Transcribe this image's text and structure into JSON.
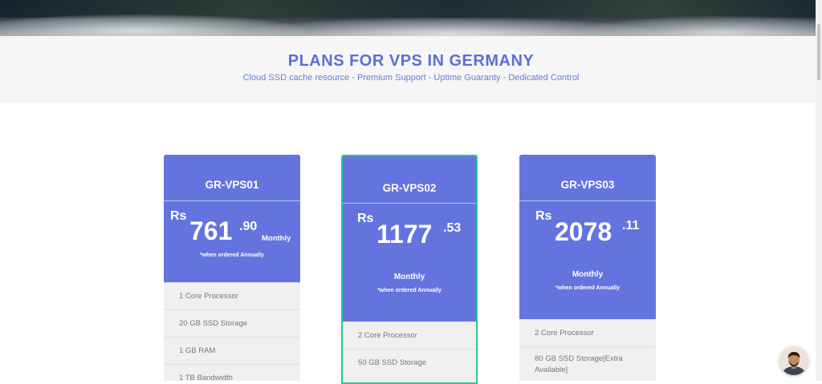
{
  "header": {
    "title": "PLANS FOR VPS IN GERMANY",
    "subtitle": "Cloud SSD cache resource - Premium Support - Uptime Guaranty - Dedicated Control"
  },
  "plans": [
    {
      "name": "GR-VPS01",
      "currency": "Rs",
      "amount": "761",
      "decimals": ".90",
      "period": "Monthly",
      "note": "*when ordered Annually",
      "features": [
        "1 Core Processor",
        "20 GB SSD Storage",
        "1 GB RAM",
        "1 TB Bandwidth"
      ]
    },
    {
      "name": "GR-VPS02",
      "currency": "Rs",
      "amount": "1177",
      "decimals": ".53",
      "period": "Monthly",
      "note": "*when ordered Annually",
      "features": [
        "2 Core Processor",
        "50 GB SSD Storage"
      ]
    },
    {
      "name": "GR-VPS03",
      "currency": "Rs",
      "amount": "2078",
      "decimals": ".11",
      "period": "Monthly",
      "note": "*when ordered Annually",
      "features": [
        "2 Core Processor",
        "80 GB SSD Storage[Extra Available]"
      ]
    }
  ],
  "chat": {
    "icon": "support-avatar-icon"
  },
  "colors": {
    "accent": "#6474de",
    "featured_border": "#2ec39b",
    "title": "#5b6fdc"
  }
}
